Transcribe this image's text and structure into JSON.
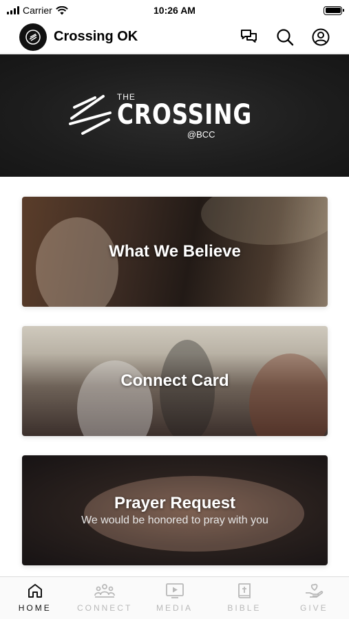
{
  "status_bar": {
    "carrier": "Carrier",
    "time": "10:26 AM"
  },
  "header": {
    "title": "Crossing OK",
    "icons": [
      "chat-icon",
      "search-icon",
      "profile-icon"
    ]
  },
  "banner": {
    "logo_small": "THE",
    "logo_main": "CROSSING",
    "logo_sub": "@BCC"
  },
  "cards": [
    {
      "title": "What We Believe",
      "subtitle": ""
    },
    {
      "title": "Connect Card",
      "subtitle": ""
    },
    {
      "title": "Prayer Request",
      "subtitle": "We would be honored to pray with you"
    }
  ],
  "tabs": [
    {
      "label": "HOME",
      "icon": "home-icon",
      "active": true
    },
    {
      "label": "CONNECT",
      "icon": "people-icon",
      "active": false
    },
    {
      "label": "MEDIA",
      "icon": "play-icon",
      "active": false
    },
    {
      "label": "BIBLE",
      "icon": "bible-icon",
      "active": false
    },
    {
      "label": "GIVE",
      "icon": "give-icon",
      "active": false
    }
  ],
  "colors": {
    "active_tab": "#111111",
    "inactive_tab": "#b8b8b8",
    "banner_bg": "#1d1d1d"
  }
}
